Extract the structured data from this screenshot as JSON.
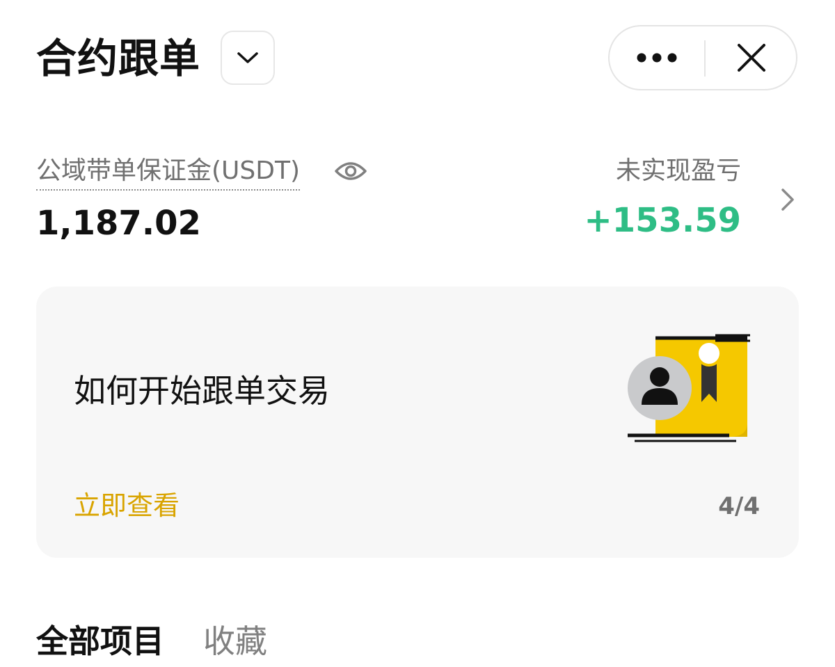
{
  "header": {
    "title": "合约跟单",
    "dropdown_icon": "chevron-down-icon",
    "more_icon": "more-dots-icon",
    "close_icon": "close-icon"
  },
  "summary": {
    "margin_label": "公域带单保证金(USDT)",
    "margin_value": "1,187.02",
    "pnl_label": "未实现盈亏",
    "pnl_value": "+153.59",
    "pnl_color": "#2ebd85"
  },
  "card": {
    "title": "如何开始跟单交易",
    "link": "立即查看",
    "link_color": "#d9a400",
    "page_indicator": "4/4",
    "illustration_icon": "certificate-avatar-icon"
  },
  "tabs": [
    {
      "label": "全部项目",
      "active": true
    },
    {
      "label": "收藏",
      "active": false
    }
  ]
}
